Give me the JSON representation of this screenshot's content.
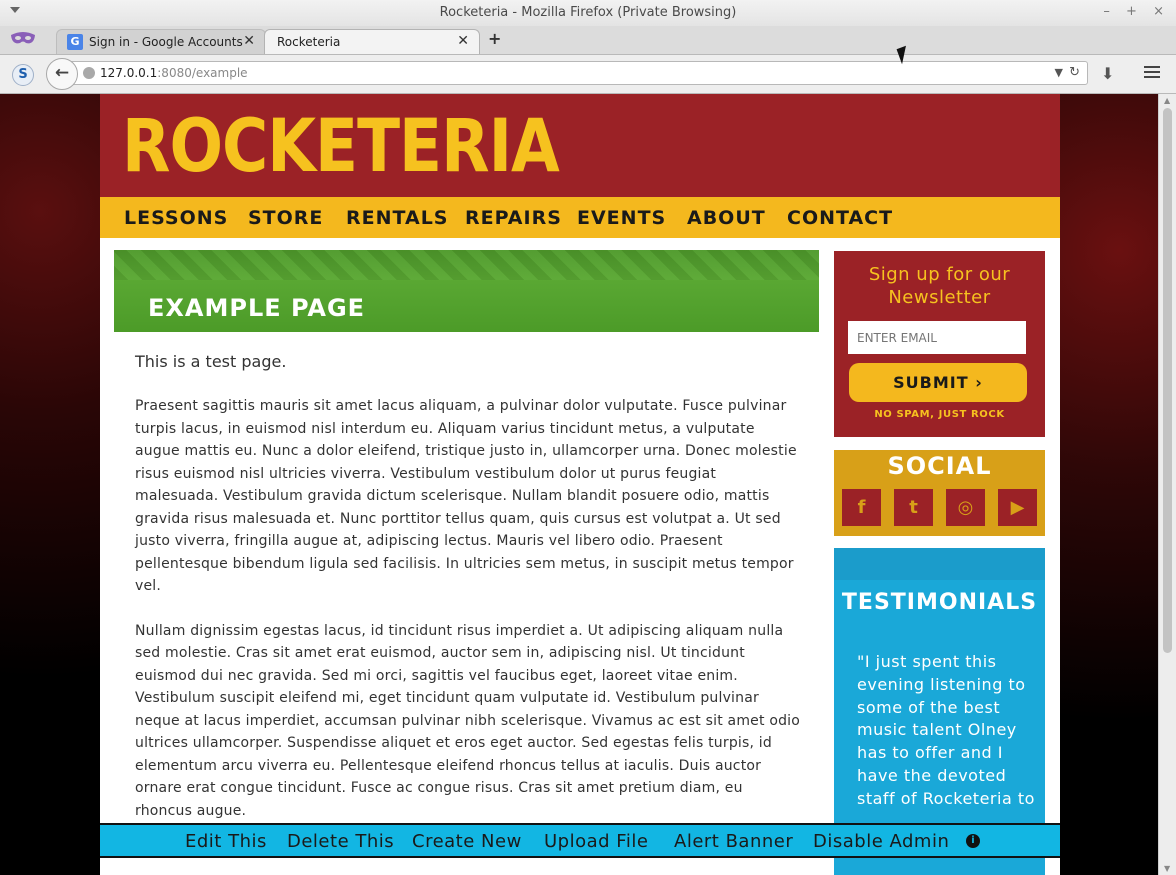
{
  "window": {
    "title": "Rocketeria - Mozilla Firefox (Private Browsing)"
  },
  "tabs": [
    {
      "label": "Sign in - Google Accounts",
      "favicon": "G",
      "active": false
    },
    {
      "label": "Rocketeria",
      "active": true
    }
  ],
  "tab_controls": {
    "close_glyph": "✕",
    "new_tab_glyph": "+"
  },
  "urlbar": {
    "host": "127.0.0.1",
    "rest": ":8080/example"
  },
  "site": {
    "logo": "ROCKETERIA",
    "nav": [
      "LESSONS",
      "STORE",
      "RENTALS",
      "REPAIRS",
      "EVENTS",
      "ABOUT",
      "CONTACT"
    ],
    "page_title": "EXAMPLE PAGE",
    "lead": "This is a test page.",
    "paragraphs": [
      "Praesent sagittis mauris sit amet lacus aliquam, a pulvinar dolor vulputate. Fusce pulvinar turpis lacus, in euismod nisl interdum eu. Aliquam varius tincidunt metus, a vulputate augue mattis eu. Nunc a dolor eleifend, tristique justo in, ullamcorper urna. Donec molestie risus euismod nisl ultricies viverra. Vestibulum vestibulum dolor ut purus feugiat malesuada. Vestibulum gravida dictum scelerisque. Nullam blandit posuere odio, mattis gravida risus malesuada et. Nunc porttitor tellus quam, quis cursus est volutpat a. Ut sed justo viverra, fringilla augue at, adipiscing lectus. Mauris vel libero odio. Praesent pellentesque bibendum ligula sed facilisis. In ultricies sem metus, in suscipit metus tempor vel.",
      "Nullam dignissim egestas lacus, id tincidunt risus imperdiet a. Ut adipiscing aliquam nulla sed molestie. Cras sit amet erat euismod, auctor sem in, adipiscing nisl. Ut tincidunt euismod dui nec gravida. Sed mi orci, sagittis vel faucibus eget, laoreet vitae enim. Vestibulum suscipit eleifend mi, eget tincidunt quam vulputate id. Vestibulum pulvinar neque at lacus imperdiet, accumsan pulvinar nibh scelerisque. Vivamus ac est sit amet odio ultrices ullamcorper. Suspendisse aliquet et eros eget auctor. Sed egestas felis turpis, id elementum arcu viverra eu. Pellentesque eleifend rhoncus tellus at iaculis. Duis auctor ornare erat congue tincidunt. Fusce ac congue risus. Cras sit amet pretium diam, eu rhoncus augue."
    ],
    "newsletter": {
      "title": "Sign up for our Newsletter",
      "email_placeholder": "ENTER EMAIL",
      "submit": "SUBMIT ›",
      "note": "NO SPAM, JUST ROCK"
    },
    "social": {
      "title": "SOCIAL",
      "icons": [
        {
          "name": "facebook-icon",
          "glyph": "f"
        },
        {
          "name": "twitter-icon",
          "glyph": "t"
        },
        {
          "name": "instagram-icon",
          "glyph": "◎"
        },
        {
          "name": "youtube-icon",
          "glyph": "▶"
        }
      ]
    },
    "testimonials": {
      "title": "TESTIMONIALS",
      "quote": "\"I just spent this evening listening to some of the best music talent Olney has to offer and I have the devoted staff of Rocketeria to"
    }
  },
  "admin_bar": {
    "items": [
      "Edit This",
      "Delete This",
      "Create New",
      "Upload File",
      "Alert Banner",
      "Disable Admin"
    ],
    "info_glyph": "i"
  },
  "colors": {
    "header_red": "#9b2226",
    "nav_yellow": "#f4b81e",
    "logo_yellow": "#f6c21f",
    "banner_green": "#5aa833",
    "testimonial_blue": "#1aa8d8",
    "admin_cyan": "#12b6e3"
  }
}
